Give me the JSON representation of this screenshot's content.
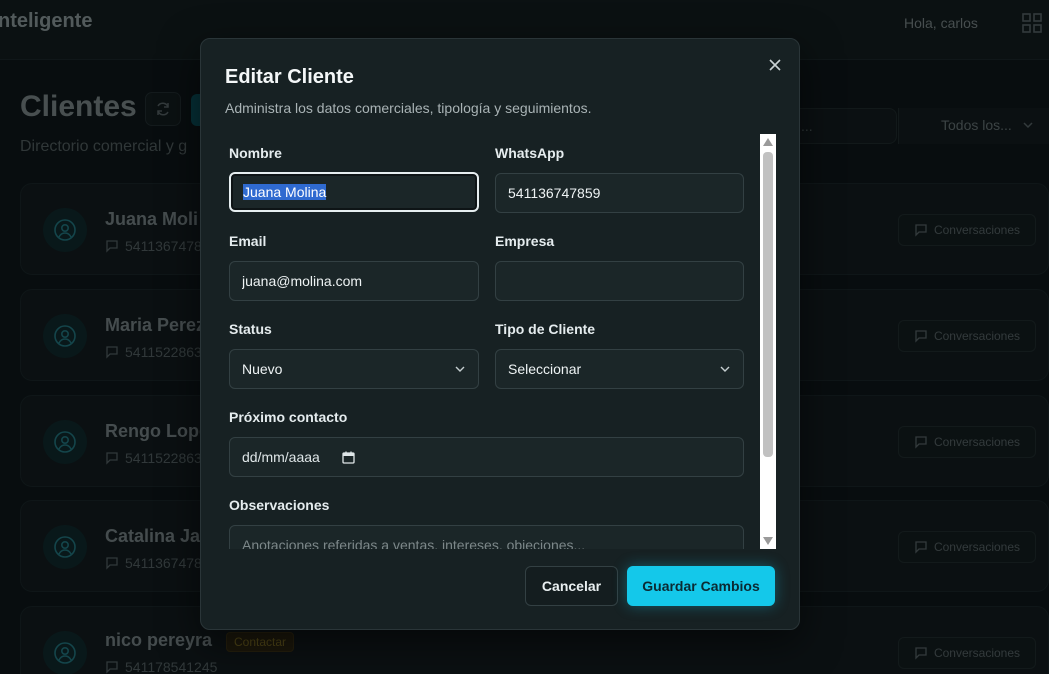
{
  "app": {
    "brand": "nteligente",
    "greeting": "Hola, carlos",
    "page_title": "Clientes",
    "page_subtitle": "Directorio comercial y g",
    "search_placeholder": "...",
    "filter_label": "Todos los..."
  },
  "clients": [
    {
      "name": "Juana Moli",
      "phone": "5411367478",
      "badge": "",
      "action": "Conversaciones"
    },
    {
      "name": "Maria Perez",
      "phone": "5411522863",
      "badge": "",
      "action": "Conversaciones"
    },
    {
      "name": "Rengo Lope",
      "phone": "5411522863",
      "badge": "",
      "action": "Conversaciones"
    },
    {
      "name": "Catalina Ja",
      "phone": "5411367478",
      "badge": "",
      "action": "Conversaciones"
    },
    {
      "name": "nico pereyra",
      "phone": "541178541245",
      "badge": "Contactar",
      "action": "Conversaciones"
    }
  ],
  "modal": {
    "title": "Editar Cliente",
    "description": "Administra los datos comerciales, tipología y seguimientos.",
    "fields": {
      "nombre": {
        "label": "Nombre",
        "value": "Juana Molina"
      },
      "whatsapp": {
        "label": "WhatsApp",
        "value": "541136747859"
      },
      "email": {
        "label": "Email",
        "value": "juana@molina.com"
      },
      "empresa": {
        "label": "Empresa",
        "value": ""
      },
      "status": {
        "label": "Status",
        "value": "Nuevo"
      },
      "tipo_cliente": {
        "label": "Tipo de Cliente",
        "value": "Seleccionar"
      },
      "proximo_contacto": {
        "label": "Próximo contacto",
        "placeholder": "dd/mm/aaaa"
      },
      "observaciones": {
        "label": "Observaciones",
        "placeholder": "Anotaciones referidas a ventas, intereses, objeciones..."
      }
    },
    "buttons": {
      "cancel": "Cancelar",
      "save": "Guardar Cambios"
    }
  },
  "colors": {
    "accent": "#14c8ea",
    "modal_bg": "#172123",
    "page_bg": "#0d1517"
  }
}
